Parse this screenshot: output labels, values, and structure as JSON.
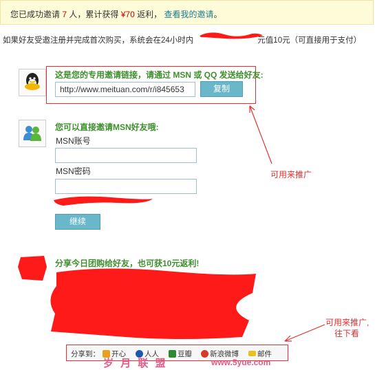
{
  "banner": {
    "prefix": "您已成功邀请",
    "invite_count": "7",
    "mid": "人，累计获得",
    "reward": "¥70",
    "suffix": "返利，",
    "link": "查看我的邀请",
    "end": "。"
  },
  "info_text_left": "如果好友受邀注册并完成首次购买，系统会在24小时内",
  "info_text_right": "元值10元（可直接用于支付）",
  "invite_link": {
    "title": "这是您的专用邀请链接，请通过 MSN 或 QQ 发送给好友:",
    "url": "http://www.meituan.com/r/i845653",
    "copy_label": "复制"
  },
  "msn": {
    "title": "您可以直接邀请MSN好友哦:",
    "account_label": "MSN账号",
    "password_label": "MSN密码",
    "continue_label": "继续"
  },
  "share": {
    "title": "分享今日团购给好友，也可获10元返利!",
    "bar_label": "分享到：",
    "items": [
      {
        "label": "开心",
        "color": "#e8a020"
      },
      {
        "label": "人人",
        "color": "#1a5aa8"
      },
      {
        "label": "豆瓣",
        "color": "#2e8a2e"
      },
      {
        "label": "新浪微博",
        "color": "#d83a2a"
      },
      {
        "label": "邮件",
        "color": "#e8c020"
      }
    ]
  },
  "annotations": {
    "promote": "可用来推广",
    "promote2_line1": "可用来推广,",
    "promote2_line2": "往下看"
  },
  "watermark": {
    "cn": "岁 月 联 盟",
    "url": "www.5yue.com"
  },
  "colors": {
    "accent_green": "#3f8f2e",
    "annotation_red": "#e03030",
    "button_blue": "#69b7c9"
  }
}
